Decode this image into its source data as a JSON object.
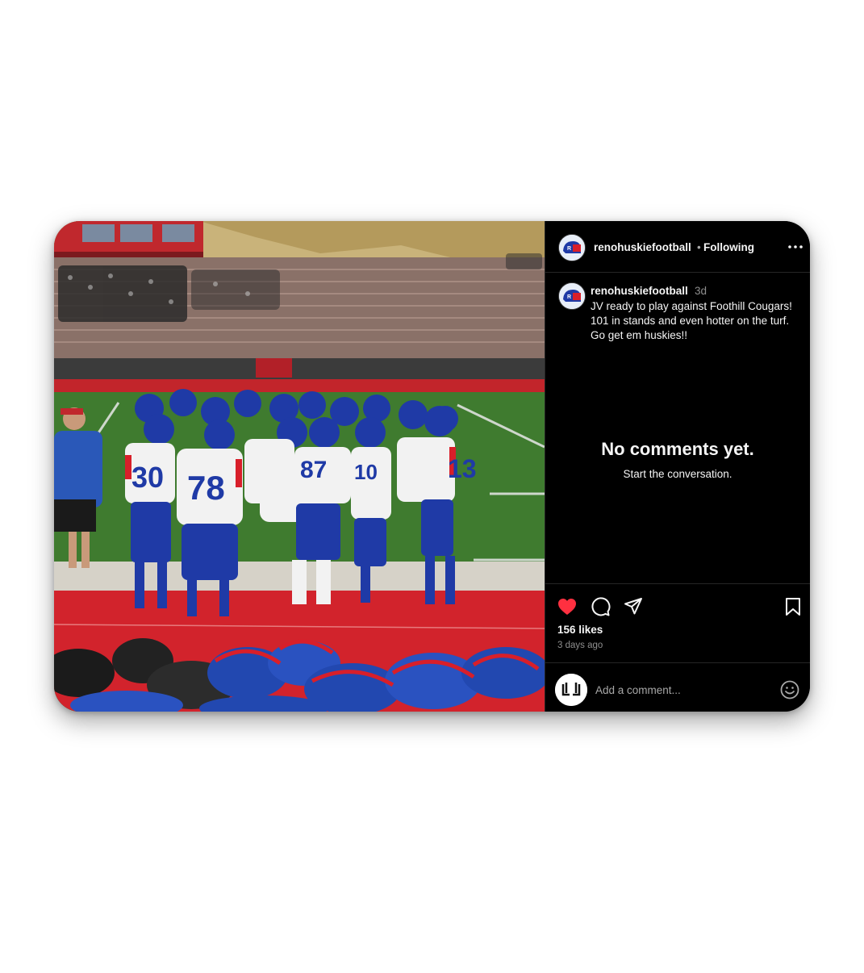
{
  "post": {
    "username": "renohuskiefootball",
    "separator": "•",
    "follow_status": "Following",
    "more_icon": "more-horizontal-icon",
    "caption": {
      "username": "renohuskiefootball",
      "time": "3d",
      "text": "JV ready to play against Foothill Cougars!\n101 in stands and even hotter on the turf.\nGo get em huskies!!"
    },
    "empty_state": {
      "title": "No comments yet.",
      "subtitle": "Start the conversation."
    },
    "actions": {
      "like_icon": "heart-filled-icon",
      "comment_icon": "comment-icon",
      "share_icon": "send-icon",
      "save_icon": "bookmark-icon"
    },
    "likes": "156 likes",
    "posted_ago": "3 days ago",
    "comment_box": {
      "placeholder": "Add a comment...",
      "emoji_icon": "emoji-icon"
    },
    "photo": {
      "jersey_numbers": [
        "30",
        "78",
        "87",
        "10",
        "13"
      ]
    }
  },
  "colors": {
    "like": "#ff3040",
    "background": "#000000",
    "team_blue": "#1f3aa6",
    "team_red": "#d81f2a"
  }
}
